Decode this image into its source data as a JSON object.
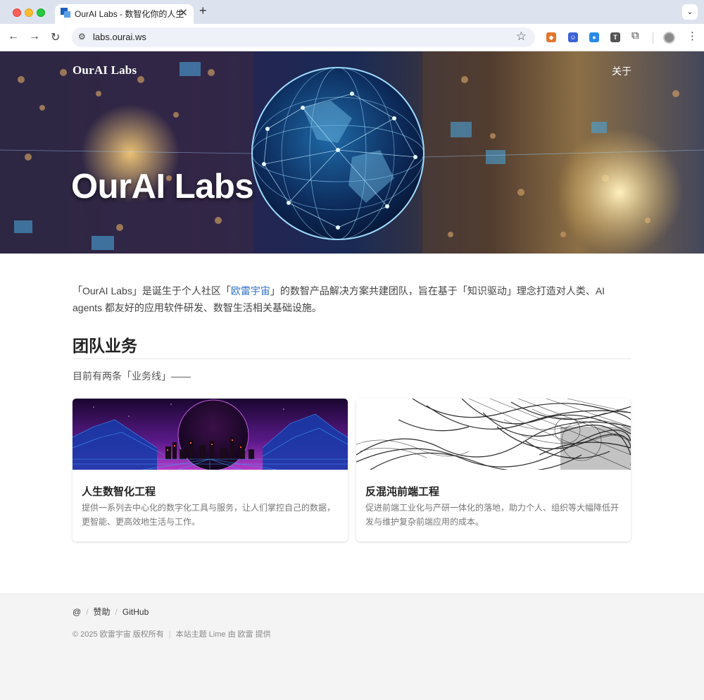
{
  "browser": {
    "tab_title": "OurAI Labs - 数智化你的人生",
    "url": "labs.ourai.ws"
  },
  "nav": {
    "brand": "OurAI Labs",
    "about_label": "关于"
  },
  "hero": {
    "title": "OurAI Labs"
  },
  "intro": {
    "text_before": "「OurAI Labs」是诞生于个人社区「",
    "link_text": "欧雷宇宙",
    "text_after": "」的数智产品解决方案共建团队，旨在基于「知识驱动」理念打造对人类、AI agents 都友好的应用软件研发、数智生活相关基础设施。"
  },
  "section": {
    "title": "团队业务",
    "subtitle": "目前有两条「业务线」——"
  },
  "cards": [
    {
      "title": "人生数智化工程",
      "description": "提供一系列去中心化的数字化工具与服务，让人们掌控自己的数据，更智能、更高效地生活与工作。"
    },
    {
      "title": "反混沌前端工程",
      "description": "促进前端工业化与产研一体化的落地，助力个人、组织等大幅降低开发与维护复杂前端应用的成本。"
    }
  ],
  "footer": {
    "links": [
      "@",
      "赞助",
      "GitHub"
    ],
    "copyright": "© 2025 欧雷宇宙 版权所有",
    "theme_credit": "本站主题 Lime 由 欧雷 提供"
  }
}
